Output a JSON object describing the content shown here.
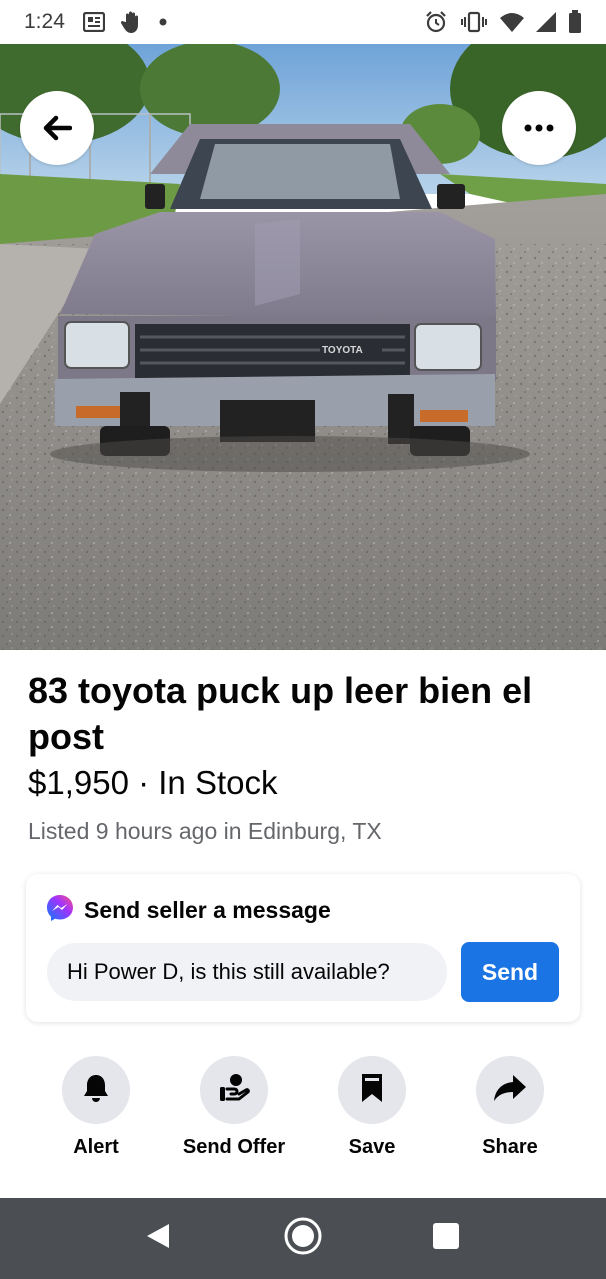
{
  "status_bar": {
    "time": "1:24",
    "left_icons": [
      "news-icon",
      "hand-icon",
      "dot-icon"
    ],
    "right_icons": [
      "alarm-icon",
      "vibrate-icon",
      "wifi-icon",
      "signal-icon",
      "battery-icon"
    ]
  },
  "hero": {
    "back_icon": "arrow-left-icon",
    "more_icon": "ellipsis-icon",
    "grille_badge": "TOYOTA",
    "colors": {
      "sky": "#8fb9dc",
      "truck": "#8e8a99",
      "road": "#8a8a88",
      "grass": "#6d9b45"
    }
  },
  "listing": {
    "title": "83 toyota puck up  leer bien el post",
    "price_line": "$1,950 · In Stock",
    "meta": "Listed 9 hours ago in Edinburg, TX"
  },
  "message": {
    "header": "Send seller a message",
    "input_value": "Hi Power D, is this still available?",
    "send_label": "Send",
    "accent_color": "#1b74e4"
  },
  "actions": [
    {
      "label": "Alert",
      "icon": "bell-icon"
    },
    {
      "label": "Send Offer",
      "icon": "offer-icon"
    },
    {
      "label": "Save",
      "icon": "bookmark-icon"
    },
    {
      "label": "Share",
      "icon": "share-icon"
    }
  ],
  "nav_bar": {
    "icons": [
      "back-triangle-icon",
      "home-circle-icon",
      "recents-square-icon"
    ]
  }
}
